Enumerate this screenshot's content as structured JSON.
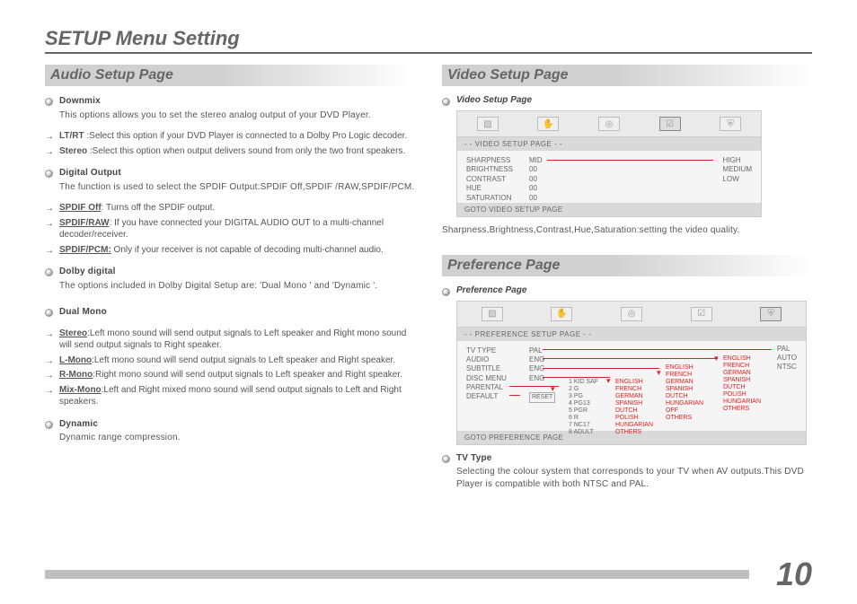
{
  "title": "SETUP Menu Setting",
  "page_number": "10",
  "left": {
    "heading": "Audio Setup Page",
    "downmix": {
      "title": "Downmix",
      "body": "This options allows you to set the stereo analog output of your DVD Player.",
      "s1_label": "LT/RT",
      "s1_body": " :Select  this option if your DVD Player  is  connected  to  a Dolby Pro Logic decoder.",
      "s2_label": "Stereo",
      "s2_body": " :Select this option when output delivers sound from only the two  front speakers."
    },
    "digital": {
      "title": "Digital Output",
      "body": "The function is used to select  the SPDIF Output:SPDIF Off,SPDIF /RAW,SPDIF/PCM.",
      "s1_label": "SPDIF Off",
      "s1_body": ": Turns off the SPDIF output.",
      "s2_label": "SPDIF/RAW",
      "s2_body": ":  If you have connected  your  DIGITAL AUDIO OUT to a multi-channel decoder/receiver.",
      "s3_label": "SPDIF/PCM:",
      "s3_body": "  Only if your receiver is not capable of decoding  multi-channel audio."
    },
    "dolby": {
      "title": "Dolby digital",
      "body": "The options included in Dolby Digital Setup are: 'Dual Mono ' and  'Dynamic '."
    },
    "dualmono": {
      "title": "Dual Mono",
      "s1_label": "Stereo",
      "s1_body": ":Left mono sound will send output signals to Left speaker and Right mono sound will send output signals to Right speaker.",
      "s2_label": "L-Mono",
      "s2_body": ":Left mono sound will send output signals to Left speaker and Right speaker.",
      "s3_label": "R-Mono",
      "s3_body": ":Right mono sound will send output signals to Left speaker and Right speaker.",
      "s4_label": "Mix-Mono",
      "s4_body": ":Left and Right mixed mono sound will send output signals  to Left and Right speakers."
    },
    "dynamic": {
      "title": "Dynamic",
      "body": "Dynamic range compression."
    }
  },
  "right": {
    "video_heading": "Video Setup Page",
    "video_sub": "Video Setup Page",
    "video_osd": {
      "header": "- -  VIDEO SETUP PAGE  - -",
      "rows": [
        {
          "c1": "SHARPNESS",
          "c2": "MID"
        },
        {
          "c1": "BRIGHTNESS",
          "c2": "00"
        },
        {
          "c1": "CONTRAST",
          "c2": "00"
        },
        {
          "c1": "HUE",
          "c2": "00"
        },
        {
          "c1": "SATURATION",
          "c2": "00"
        }
      ],
      "side": [
        "HIGH",
        "MEDIUM",
        "LOW"
      ],
      "footer": "GOTO VIDEO SETUP PAGE"
    },
    "video_body": "Sharpness,Brightness,Contrast,Hue,Saturation:setting the video quality.",
    "pref_heading": "Preference Page",
    "pref_sub": "Preference Page",
    "pref_osd": {
      "header": "- -  PREFERENCE SETUP PAGE  - -",
      "rows": [
        {
          "c1": "TV TYPE",
          "c2": "PAL"
        },
        {
          "c1": "AUDIO",
          "c2": "ENG"
        },
        {
          "c1": "SUBTITLE",
          "c2": "ENG"
        },
        {
          "c1": "DISC MENU",
          "c2": "ENG"
        },
        {
          "c1": "PARENTAL",
          "c2": ""
        },
        {
          "c1": "DEFAULT",
          "c2": "RESET"
        }
      ],
      "parental": [
        "1 KID SAF",
        "2 G",
        "3 PG",
        "4 PG13",
        "5 PGR",
        "6 R",
        "7 NC17",
        "8 ADULT"
      ],
      "langs": [
        "ENGLISH",
        "FRENCH",
        "GERMAN",
        "SPANISH",
        "DUTCH",
        "POLISH",
        "HUNGARIAN",
        "OTHERS"
      ],
      "langs2": [
        "ENGLISH",
        "FRENCH",
        "GERMAN",
        "SPANISH",
        "DUTCH",
        "HUNGARIAN",
        "OFF",
        "OTHERS"
      ],
      "langs3": [
        "ENGLISH",
        "FRENCH",
        "GERMAN",
        "SPANISH",
        "DUTCH",
        "POLISH",
        "HUNGARIAN",
        "OTHERS"
      ],
      "tv": [
        "PAL",
        "AUTO",
        "NTSC"
      ],
      "footer": "GOTO PREFERENCE PAGE"
    },
    "tvtype": {
      "title": "TV Type",
      "body": "Selecting the colour system that corresponds to your TV when AV outputs.This DVD Player is compatible with both NTSC and  PAL."
    }
  }
}
